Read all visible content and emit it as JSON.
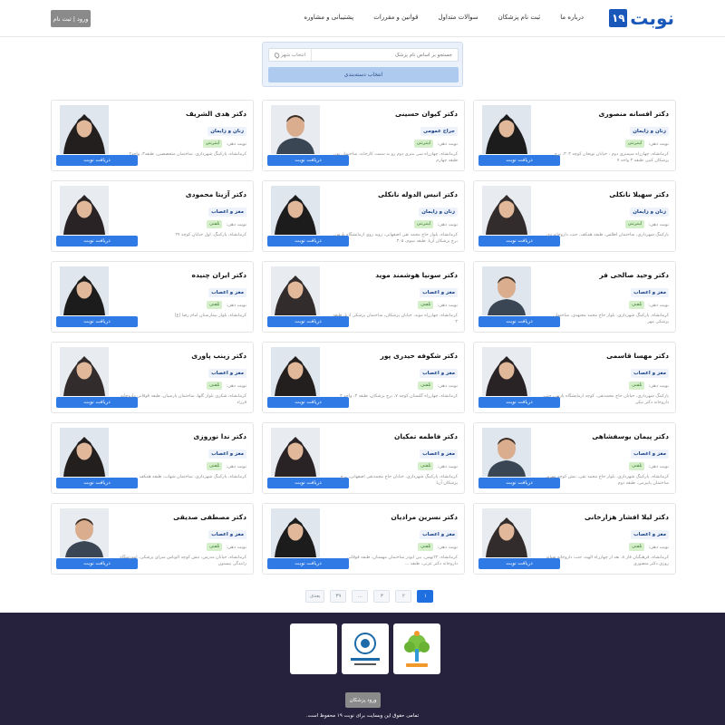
{
  "header": {
    "logo_text": "نوبت",
    "logo_number": "۱۹",
    "nav": [
      "درباره ما",
      "ثبت نام پزشکان",
      "سوالات متداول",
      "قوانین و مقررات",
      "پشتیبانی و مشاوره"
    ],
    "login_label": "ورود | ثبت نام"
  },
  "search": {
    "placeholder": "جستجو بر اساس نام پزشک",
    "city_label": "انتخاب شهر",
    "specialty_label": "انتخاب دسته‌بندی"
  },
  "card": {
    "book_label": "دریافت نوبت",
    "turn_label": "نوبت دهی:"
  },
  "doctors": [
    {
      "name": "دکتر افسانه منصوری",
      "specialty": "زنان و زایمان",
      "type": "اینترنتی",
      "address": "کرمانشاه، چهارراه سیمتری دوم ، خیابان توپخان کوچه ۳۰۳، برج پزشکان کبیر، طبقه ۳ واحد ۷"
    },
    {
      "name": "دکتر کیوان حسینی",
      "specialty": "جراح عمومی",
      "type": "اینترنتی",
      "address": "کرمانشاه، چهارراه سی متری دوم رو به سمت کارخانه، ساختمان نور، طبقه چهارم"
    },
    {
      "name": "دکتر هدی الشریف",
      "specialty": "زنان و زایمان",
      "type": "اینترنتی",
      "address": "کرمانشاه، پارکینگ شهرداری، ساختمان متخصصین، طبقه۳، واحد۲"
    },
    {
      "name": "دکتر سهیلا نانکلی",
      "specialty": "زنان و زایمان",
      "type": "اینترنتی",
      "address": "پارکینگ شهرداری، ساختمان اطلس، طبقه همکف، جنب داروخانه دی"
    },
    {
      "name": "دکتر انیس الدوله نانکلی",
      "specialty": "زنان و زایمان",
      "type": "اینترنتی",
      "address": "کرمانشاه، بلوار حاج محمد تقی اصفهانی، روبه روی آزمایشگاه پارس، برج پزشکان آریا، طبقه سوم، ۳۰۵"
    },
    {
      "name": "دکتر آزیتا محمودی",
      "specialty": "مغز و اعصاب",
      "type": "تلفنی",
      "address": "کرمانشاه، پارکینگ، اول خیابان کوچه ۲۷"
    },
    {
      "name": "دکتر وحید صالحی فر",
      "specialty": "مغز و اعصاب",
      "type": "تلفنی",
      "address": "کرمانشاه، پارکینگ شهرداری، بلوار حاج محمد مجتهدی، ساختمان پزشکی مهر"
    },
    {
      "name": "دکتر سونیا هوشمند موید",
      "specialty": "مغز و اعصاب",
      "type": "تلفنی",
      "address": "کرمانشاه، چهارراه موبد، خیابان پزشکان، ساختمان پزشکی آریا، طبقه ۳"
    },
    {
      "name": "دکتر ایران چنیده",
      "specialty": "مغز و اعصاب",
      "type": "تلفنی",
      "address": "کرمانشاه، بلوار بیمارستان امام رضا (ع)"
    },
    {
      "name": "دکتر مهسا قاسمی",
      "specialty": "مغز و اعصاب",
      "type": "تلفنی",
      "address": "پارکینگ شهرداری، خیابان حاج محمدتقی، کوچه آزمایشگاه پارس، جنب داروخانه دکتر نیکی"
    },
    {
      "name": "دکتر شکوفه حیدری پور",
      "specialty": "مغز و اعصاب",
      "type": "تلفنی",
      "address": "کرمانشاه، چهارراه گلستان کوچه ۷، برج پزشکان، طبقه ۳، واحد ۳"
    },
    {
      "name": "دکتر زینب پاوری",
      "specialty": "مغز و اعصاب",
      "type": "تلفنی",
      "address": "کرمانشاه، شکری بلوار گلها، ساختمان پارسیان، طبقه فوقانی داروخانه فرزاد"
    },
    {
      "name": "دکتر پیمان یوسفشاهی",
      "specialty": "مغز و اعصاب",
      "type": "تلفنی",
      "address": "کرمانشاه، پارکینگ شهرداری، بلوار حاج محمد تقی، نبش کوچه مهرو، ساختمان پاییزمی، طبقه دوم"
    },
    {
      "name": "دکتر فاطمه تمکیان",
      "specialty": "مغز و اعصاب",
      "type": "تلفنی",
      "address": "کرمانشاه، پارکینگ شهرداری، خیابان حاج محمدتقی اصفهانی، برج پزشکان آریا"
    },
    {
      "name": "دکتر ندا نوروزی",
      "specialty": "مغز و اعصاب",
      "type": "تلفنی",
      "address": "کرمانشاه، پارکینگ شهرداری، ساختمان شهاب، طبقه همکف"
    },
    {
      "name": "دکتر لیلا افشار هزارخانی",
      "specialty": "مغز و اعصاب",
      "type": "تلفنی",
      "address": "کرمانشاه، فرهنگیان فاز ۸، بعد از چهارراه الهیه، جنب داروخانه شبانه روزی دکتر منصوری"
    },
    {
      "name": "دکتر نسرین مرادیان",
      "specialty": "مغز و اعصاب",
      "type": "تلفنی",
      "address": "کرمانشاه، ۲۲بهمن، بین ابوذر ساختمان مهستان، طبقه فوقانی داروخانه دکتر عزتی، طبقه ..."
    },
    {
      "name": "دکتر مصطفی صدیقی",
      "specialty": "مغز و اعصاب",
      "type": "تلفنی",
      "address": "کرمانشاه، خیابان مدرس، نبش کوچه الوباس سرای پزشکی، آموزشگاه رانندگی بیستون"
    }
  ],
  "pagination": {
    "prev_label": "بعدی",
    "pages": [
      "۳۹",
      "...",
      "۳",
      "۲",
      "۱"
    ],
    "active": "۱"
  },
  "footer": {
    "login_label": "ورود پزشکان",
    "copyright": "تمامی حقوق این وبسایت برای نوبت ۱۹ محفوظ است."
  },
  "colors": {
    "brand": "#1957b9",
    "button": "#2f7ae5",
    "footer": "#26223d",
    "badge_bg": "#d4efc9"
  }
}
